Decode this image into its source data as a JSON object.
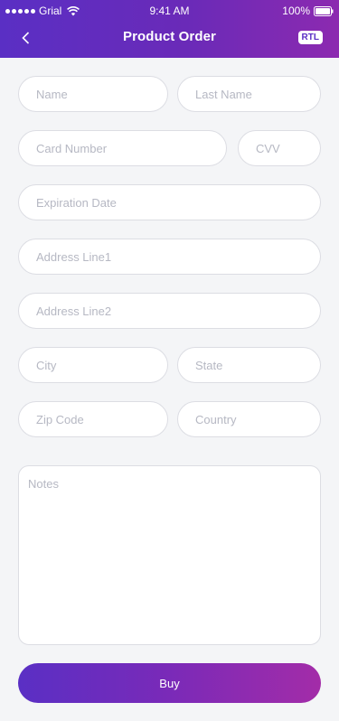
{
  "status_bar": {
    "carrier": "Grial",
    "time": "9:41 AM",
    "battery": "100%"
  },
  "nav": {
    "back_icon": "chevron-left-icon",
    "title": "Product Order",
    "rtl_label": "RTL"
  },
  "form": {
    "name": "Name",
    "last_name": "Last Name",
    "card_number": "Card Number",
    "cvv": "CVV",
    "expiration_date": "Expiration Date",
    "address_line1": "Address Line1",
    "address_line2": "Address Line2",
    "city": "City",
    "state": "State",
    "zip_code": "Zip Code",
    "country": "Country",
    "notes": "Notes",
    "buy_label": "Buy"
  },
  "colors": {
    "accent_start": "#5a2fc4",
    "accent_end": "#a32ca8",
    "placeholder": "#b6b8c3",
    "background": "#f4f5f7"
  }
}
